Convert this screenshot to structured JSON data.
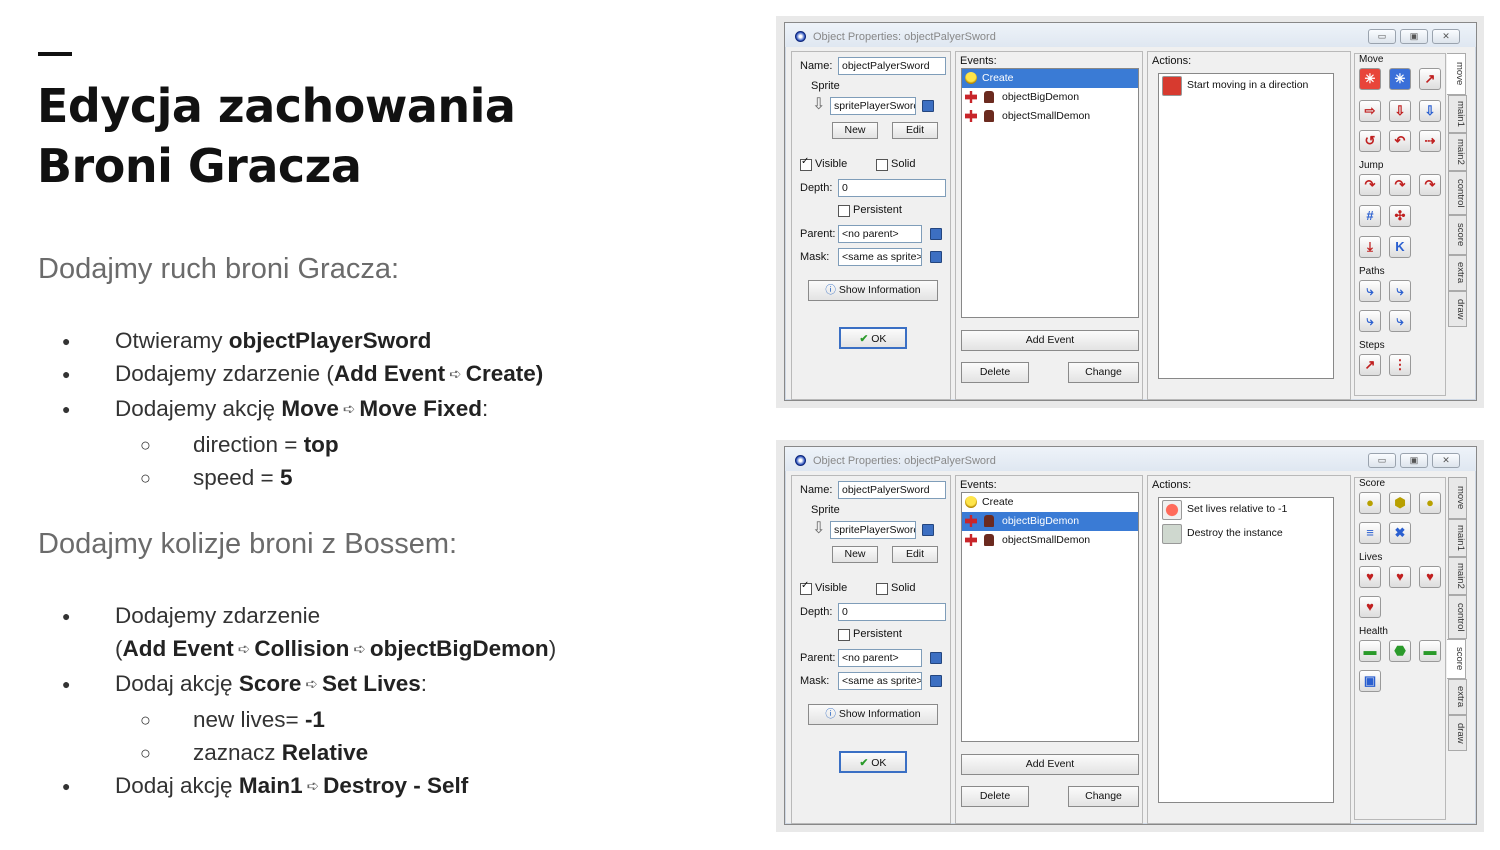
{
  "slide": {
    "title_line1": "Edycja zachowania",
    "title_line2": "Broni Gracza",
    "section1": {
      "heading": "Dodajmy ruch broni Gracza:",
      "b1_pre": "Otwieramy ",
      "b1_bold": "objectPlayerSword",
      "b2_pre": "Dodajemy zdarzenie (",
      "b2_bold1": "Add Event",
      "b2_bold2": "Create)",
      "b3_pre": "Dodajemy akcję ",
      "b3_bold1": "Move",
      "b3_bold2": "Move Fixed",
      "b3_post": ":",
      "s1_pre": "direction = ",
      "s1_bold": "top",
      "s2_pre": "speed = ",
      "s2_bold": "5"
    },
    "section2": {
      "heading": "Dodajmy kolizje broni z Bossem:",
      "b1_pre": "Dodajemy zdarzenie",
      "b1_open": "(",
      "b1_bold1": "Add Event",
      "b1_bold2": "Collision",
      "b1_bold3": "objectBigDemon",
      "b1_close": ")",
      "b2_pre": "Dodaj akcję ",
      "b2_bold1": "Score",
      "b2_bold2": "Set Lives",
      "b2_post": ":",
      "s1_pre": "new lives= ",
      "s1_bold": "-1",
      "s2_pre": "zaznacz ",
      "s2_bold": "Relative",
      "b3_pre": "Dodaj akcję ",
      "b3_bold1": "Main1",
      "b3_bold2": "Destroy - Self"
    },
    "arrow_glyph": "➪"
  },
  "window": {
    "title": "Object Properties: objectPalyerSword",
    "name_label": "Name:",
    "name_value": "objectPalyerSword",
    "sprite_label": "Sprite",
    "sprite_value": "spritePlayerSworc",
    "new_label": "New",
    "edit_label": "Edit",
    "visible_label": "Visible",
    "solid_label": "Solid",
    "depth_label": "Depth:",
    "depth_value": "0",
    "persistent_label": "Persistent",
    "parent_label": "Parent:",
    "parent_value": "<no parent>",
    "mask_label": "Mask:",
    "mask_value": "<same as sprite>",
    "show_info_label": "Show Information",
    "ok_label": "OK",
    "events_label": "Events:",
    "events": [
      "Create",
      "objectBigDemon",
      "objectSmallDemon"
    ],
    "add_event_label": "Add Event",
    "delete_label": "Delete",
    "change_label": "Change",
    "actions_label": "Actions:",
    "min_glyph": "▭",
    "max_glyph": "▣",
    "close_glyph": "✕",
    "tabs": [
      "move",
      "main1",
      "main2",
      "control",
      "score",
      "extra",
      "draw"
    ]
  },
  "screenshot1": {
    "actions": [
      "Start moving in a direction"
    ],
    "groups": [
      "Move",
      "Jump",
      "Paths",
      "Steps"
    ]
  },
  "screenshot2": {
    "actions": [
      "Set lives relative to -1",
      "Destroy the instance"
    ],
    "groups": [
      "Score",
      "Lives",
      "Health"
    ]
  }
}
